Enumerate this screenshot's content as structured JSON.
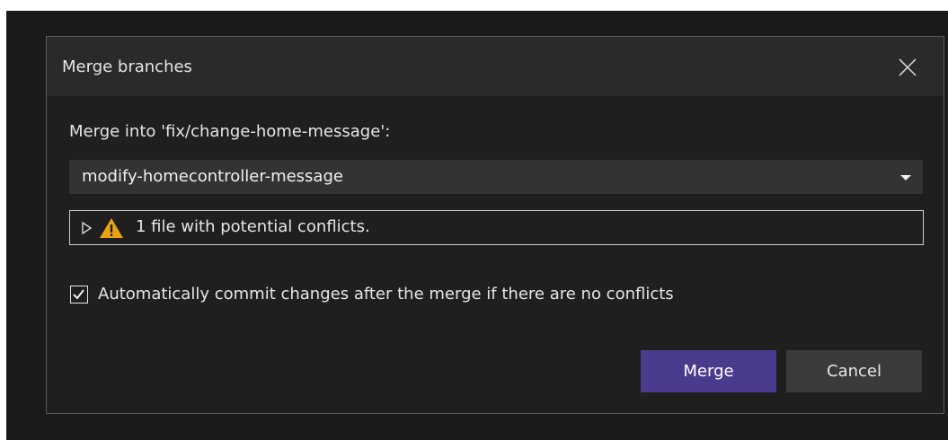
{
  "dialog": {
    "title": "Merge branches",
    "close_icon": "close-icon"
  },
  "merge_into": {
    "label": "Merge into 'fix/change-home-message':",
    "selected_branch": "modify-homecontroller-message",
    "dropdown_icon": "chevron-down-icon"
  },
  "conflicts": {
    "expand_icon": "triangle-right-icon",
    "warning_icon": "warning-icon",
    "text": "1 file with potential conflicts."
  },
  "auto_commit": {
    "checked": true,
    "label": "Automatically commit changes after the merge if there are no conflicts"
  },
  "buttons": {
    "merge_label": "Merge",
    "cancel_label": "Cancel"
  },
  "colors": {
    "background": "#1f1f1f",
    "titlebar": "#2a2a2a",
    "accent": "#4b3b8f",
    "secondary_button": "#3a3a3a",
    "warning": "#e8a317"
  }
}
